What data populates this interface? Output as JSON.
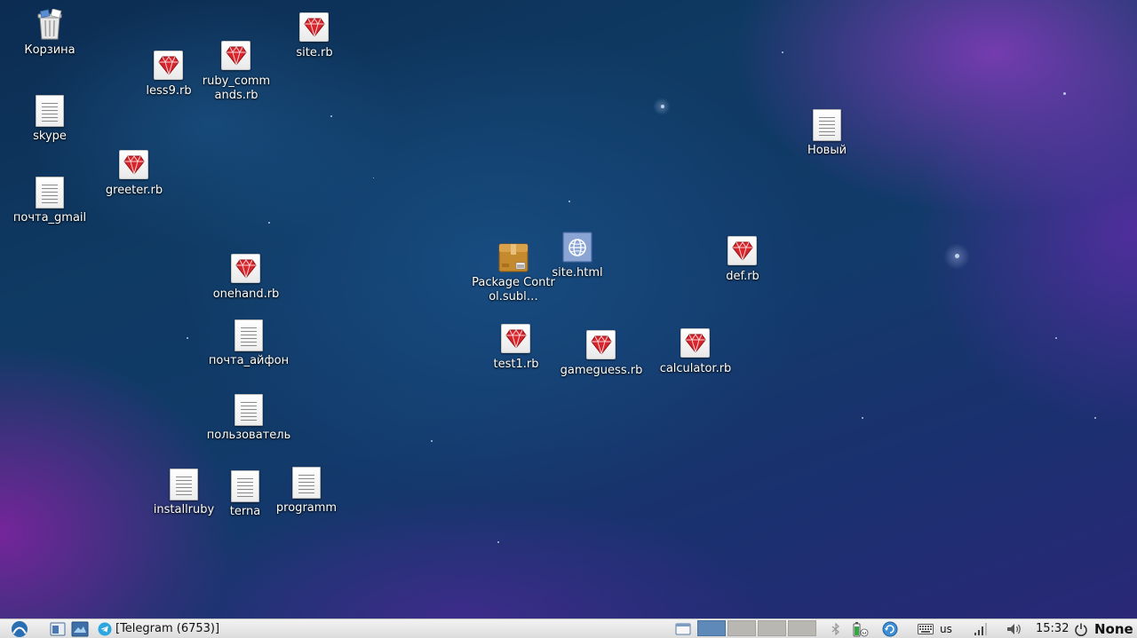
{
  "desktop": {
    "icons": [
      {
        "key": "trash",
        "label": "Корзина",
        "type": "trash"
      },
      {
        "key": "skype",
        "label": "skype",
        "type": "doc"
      },
      {
        "key": "pochta_gmail",
        "label": "почта_gmail",
        "type": "doc"
      },
      {
        "key": "less9",
        "label": "less9.rb",
        "type": "ruby"
      },
      {
        "key": "ruby_commands",
        "label": "ruby_commands.rb",
        "type": "ruby"
      },
      {
        "key": "site_rb",
        "label": "site.rb",
        "type": "ruby"
      },
      {
        "key": "greeter",
        "label": "greeter.rb",
        "type": "ruby"
      },
      {
        "key": "onehand",
        "label": "onehand.rb",
        "type": "ruby"
      },
      {
        "key": "pochta_aifon",
        "label": "почта_айфон",
        "type": "doc"
      },
      {
        "key": "polzovatel",
        "label": "пользователь",
        "type": "doc"
      },
      {
        "key": "installruby",
        "label": "installruby",
        "type": "doc"
      },
      {
        "key": "terna",
        "label": "terna",
        "type": "doc"
      },
      {
        "key": "programm",
        "label": "programm",
        "type": "doc"
      },
      {
        "key": "package_control",
        "label": "Package Control.subl…",
        "type": "package"
      },
      {
        "key": "site_html",
        "label": "site.html",
        "type": "html"
      },
      {
        "key": "test1",
        "label": "test1.rb",
        "type": "ruby"
      },
      {
        "key": "gameguess",
        "label": "gameguess.rb",
        "type": "ruby"
      },
      {
        "key": "calculator",
        "label": "calculator.rb",
        "type": "ruby"
      },
      {
        "key": "def",
        "label": "def.rb",
        "type": "ruby"
      },
      {
        "key": "novyi",
        "label": "Новый",
        "type": "doc"
      }
    ]
  },
  "taskbar": {
    "window_button_label": "[Telegram (6753)]",
    "workspaces": [
      {
        "name": "workspace-1",
        "active": true
      },
      {
        "name": "workspace-2",
        "active": false
      },
      {
        "name": "workspace-3",
        "active": false
      },
      {
        "name": "workspace-4",
        "active": false
      }
    ],
    "keyboard_layout": "us",
    "clock": "15:32",
    "power_label": "None"
  },
  "colors": {
    "ruby_red": "#d8242b",
    "taskbar_bg": "#e6e6e6",
    "active_workspace": "#5f89b8"
  }
}
